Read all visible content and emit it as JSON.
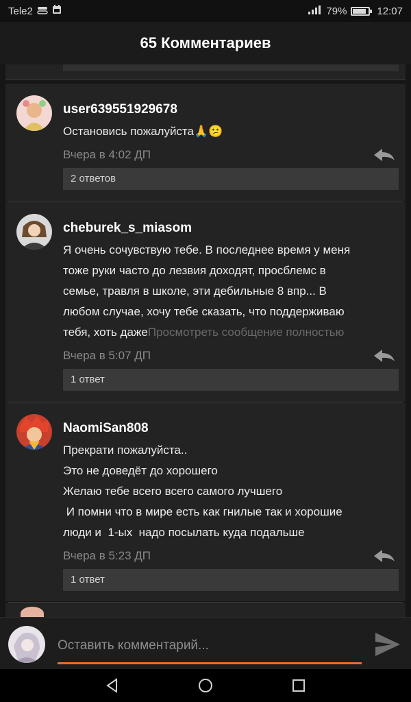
{
  "status_bar": {
    "carrier": "Tele2",
    "battery_percent": "79%",
    "time": "12:07"
  },
  "header": {
    "title": "65 Комментариев"
  },
  "comments": [
    {
      "username": "user639551929678",
      "text_lines": [
        "Остановись пожалуйста🙏😕"
      ],
      "time": "Вчера в 4:02 ДП",
      "replies_label": "2 ответов"
    },
    {
      "username": "cheburek_s_miasom",
      "text_lines": [
        "Я очень сочувствую тебе. В последнее время у меня",
        "тоже руки часто до лезвия доходят, просблемс в",
        "семье, травля в школе, эти дебильные 8 впр... В",
        "любом случае, хочу тебе сказать, что поддерживаю",
        "тебя, хоть даже"
      ],
      "more_label": "Просмотреть сообщение полностью",
      "time": "Вчера в 5:07 ДП",
      "replies_label": "1 ответ"
    },
    {
      "username": "NaomiSan808",
      "text_lines": [
        "Прекрати пожалуйста..",
        "Это не доведёт до хорошего",
        "Желаю тебе всего всего самого лучшего",
        " И помни что в мире есть как гнилые так и хорошие",
        "люди и  1-ых  надо посылать куда подальше"
      ],
      "time": "Вчера в 5:23 ДП",
      "replies_label": "1 ответ"
    }
  ],
  "composer": {
    "placeholder": "Оставить комментарий..."
  },
  "colors": {
    "accent": "#f26a2e",
    "card": "#232323",
    "background": "#161616"
  }
}
